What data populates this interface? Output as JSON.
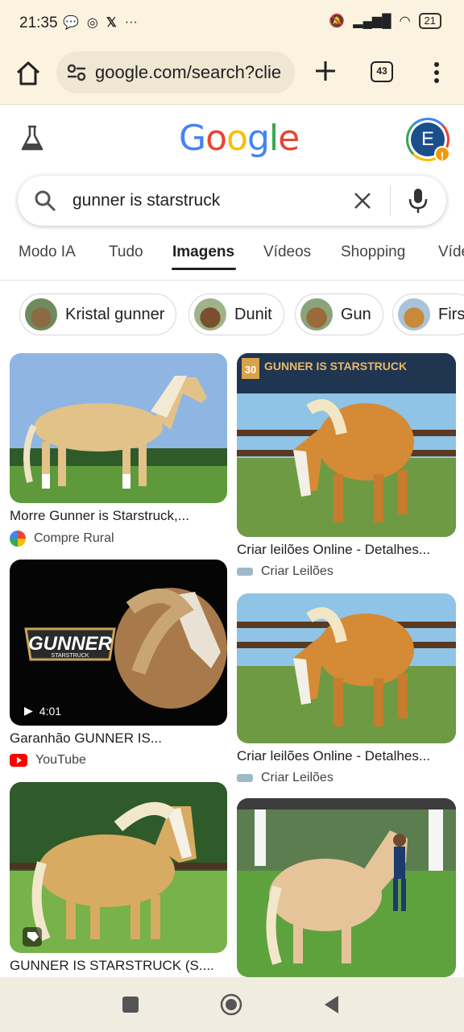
{
  "status": {
    "time": "21:35",
    "battery": "21"
  },
  "toolbar": {
    "url": "google.com/search?clie",
    "tab_count": "43"
  },
  "header": {
    "logo": "Google",
    "avatar_letter": "E",
    "warn": "!"
  },
  "search": {
    "query": "gunner is starstruck"
  },
  "nav": {
    "tabs": [
      {
        "label": "Modo IA"
      },
      {
        "label": "Tudo"
      },
      {
        "label": "Imagens"
      },
      {
        "label": "Vídeos"
      },
      {
        "label": "Shopping"
      },
      {
        "label": "Víde"
      }
    ]
  },
  "chips": [
    {
      "label": "Kristal gunner"
    },
    {
      "label": "Dunit"
    },
    {
      "label": "Gun"
    },
    {
      "label": "Firs"
    }
  ],
  "results": [
    {
      "title": "Morre Gunner is Starstruck,...",
      "source": "Compre Rural"
    },
    {
      "title": "Criar leilões Online - Detalhes...",
      "source": "Criar Leilões",
      "overlay_title": "GUNNER IS STARSTRUCK",
      "overlay_number": "30"
    },
    {
      "title": "Garanhão GUNNER IS...",
      "source": "YouTube",
      "duration": "4:01",
      "logo_text": "GUNNER",
      "logo_sub": "STARSTRUCK"
    },
    {
      "title": "Criar leilões Online - Detalhes...",
      "source": "Criar Leilões"
    },
    {
      "title": "GUNNER IS STARSTRUCK (S....",
      "source": ""
    },
    {
      "title": "",
      "source": ""
    }
  ],
  "colors": {
    "accent": "#1a73e8",
    "status_bg": "#fbf3df",
    "horse": "#d9a24a"
  }
}
